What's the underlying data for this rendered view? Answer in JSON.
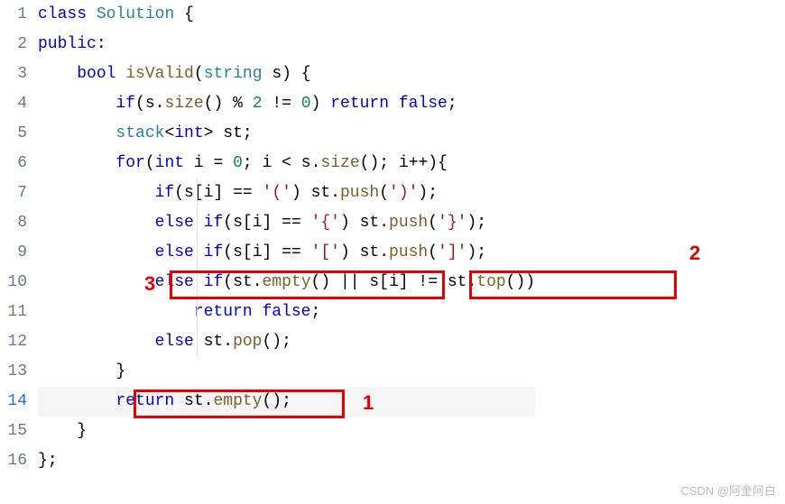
{
  "code": {
    "lines": [
      {
        "num": "1",
        "tokens": [
          [
            "",
            "kw",
            "class"
          ],
          [
            " ",
            "",
            ""
          ],
          [
            "",
            "cls",
            "Solution"
          ],
          [
            " ",
            "",
            ""
          ],
          [
            "",
            "brace",
            "{"
          ]
        ]
      },
      {
        "num": "2",
        "tokens": [
          [
            "",
            "kw",
            "public"
          ],
          [
            "",
            "op",
            ":"
          ]
        ]
      },
      {
        "num": "3",
        "tokens": [
          [
            "    ",
            "",
            ""
          ],
          [
            "",
            "kw",
            "bool"
          ],
          [
            " ",
            "",
            ""
          ],
          [
            "",
            "fn",
            "isValid"
          ],
          [
            "",
            "brace",
            "("
          ],
          [
            "",
            "cls",
            "string"
          ],
          [
            " ",
            "",
            ""
          ],
          [
            "",
            "id",
            "s"
          ],
          [
            "",
            "brace",
            ")"
          ],
          [
            " ",
            "",
            ""
          ],
          [
            "",
            "brace",
            "{"
          ]
        ]
      },
      {
        "num": "4",
        "tokens": [
          [
            "        ",
            "",
            ""
          ],
          [
            "",
            "kw",
            "if"
          ],
          [
            "",
            "brace",
            "("
          ],
          [
            "",
            "id",
            "s"
          ],
          [
            "",
            "op",
            "."
          ],
          [
            "",
            "fn",
            "size"
          ],
          [
            "",
            "brace",
            "()"
          ],
          [
            " ",
            "",
            ""
          ],
          [
            "",
            "op",
            "%"
          ],
          [
            " ",
            "",
            ""
          ],
          [
            "",
            "num",
            "2"
          ],
          [
            " ",
            "",
            ""
          ],
          [
            "",
            "op",
            "!="
          ],
          [
            " ",
            "",
            ""
          ],
          [
            "",
            "num",
            "0"
          ],
          [
            "",
            "brace",
            ")"
          ],
          [
            " ",
            "",
            ""
          ],
          [
            "",
            "kw",
            "return"
          ],
          [
            " ",
            "",
            ""
          ],
          [
            "",
            "kw",
            "false"
          ],
          [
            "",
            "op",
            ";"
          ]
        ]
      },
      {
        "num": "5",
        "tokens": [
          [
            "        ",
            "",
            ""
          ],
          [
            "",
            "cls",
            "stack"
          ],
          [
            "",
            "op",
            "<"
          ],
          [
            "",
            "kw",
            "int"
          ],
          [
            "",
            "op",
            ">"
          ],
          [
            " ",
            "",
            ""
          ],
          [
            "",
            "id",
            "st"
          ],
          [
            "",
            "op",
            ";"
          ]
        ]
      },
      {
        "num": "6",
        "tokens": [
          [
            "        ",
            "",
            ""
          ],
          [
            "",
            "kw",
            "for"
          ],
          [
            "",
            "brace",
            "("
          ],
          [
            "",
            "kw",
            "int"
          ],
          [
            " ",
            "",
            ""
          ],
          [
            "",
            "id",
            "i"
          ],
          [
            " ",
            "",
            ""
          ],
          [
            "",
            "op",
            "="
          ],
          [
            " ",
            "",
            ""
          ],
          [
            "",
            "num",
            "0"
          ],
          [
            "",
            "op",
            ";"
          ],
          [
            " ",
            "",
            ""
          ],
          [
            "",
            "id",
            "i"
          ],
          [
            " ",
            "",
            ""
          ],
          [
            "",
            "op",
            "<"
          ],
          [
            " ",
            "",
            ""
          ],
          [
            "",
            "id",
            "s"
          ],
          [
            "",
            "op",
            "."
          ],
          [
            "",
            "fn",
            "size"
          ],
          [
            "",
            "brace",
            "()"
          ],
          [
            "",
            "op",
            ";"
          ],
          [
            " ",
            "",
            ""
          ],
          [
            "",
            "id",
            "i"
          ],
          [
            "",
            "op",
            "++"
          ],
          [
            "",
            "brace",
            ")"
          ],
          [
            "",
            "brace",
            "{"
          ]
        ]
      },
      {
        "num": "7",
        "tokens": [
          [
            "            ",
            "",
            ""
          ],
          [
            "",
            "kw",
            "if"
          ],
          [
            "",
            "brace",
            "("
          ],
          [
            "",
            "id",
            "s"
          ],
          [
            "",
            "brace",
            "["
          ],
          [
            "",
            "id",
            "i"
          ],
          [
            "",
            "brace",
            "]"
          ],
          [
            " ",
            "",
            ""
          ],
          [
            "",
            "op",
            "=="
          ],
          [
            " ",
            "",
            ""
          ],
          [
            "",
            "str",
            "'('"
          ],
          [
            "",
            "brace",
            ")"
          ],
          [
            " ",
            "",
            ""
          ],
          [
            "",
            "id",
            "st"
          ],
          [
            "",
            "op",
            "."
          ],
          [
            "",
            "fn",
            "push"
          ],
          [
            "",
            "brace",
            "("
          ],
          [
            "",
            "str",
            "')'"
          ],
          [
            "",
            "brace",
            ")"
          ],
          [
            "",
            "op",
            ";"
          ]
        ]
      },
      {
        "num": "8",
        "tokens": [
          [
            "            ",
            "",
            ""
          ],
          [
            "",
            "kw",
            "else"
          ],
          [
            " ",
            "",
            ""
          ],
          [
            "",
            "kw",
            "if"
          ],
          [
            "",
            "brace",
            "("
          ],
          [
            "",
            "id",
            "s"
          ],
          [
            "",
            "brace",
            "["
          ],
          [
            "",
            "id",
            "i"
          ],
          [
            "",
            "brace",
            "]"
          ],
          [
            " ",
            "",
            ""
          ],
          [
            "",
            "op",
            "=="
          ],
          [
            " ",
            "",
            ""
          ],
          [
            "",
            "str",
            "'{'"
          ],
          [
            "",
            "brace",
            ")"
          ],
          [
            " ",
            "",
            ""
          ],
          [
            "",
            "id",
            "st"
          ],
          [
            "",
            "op",
            "."
          ],
          [
            "",
            "fn",
            "push"
          ],
          [
            "",
            "brace",
            "("
          ],
          [
            "",
            "str",
            "'}'"
          ],
          [
            "",
            "brace",
            ")"
          ],
          [
            "",
            "op",
            ";"
          ]
        ]
      },
      {
        "num": "9",
        "tokens": [
          [
            "            ",
            "",
            ""
          ],
          [
            "",
            "kw",
            "else"
          ],
          [
            " ",
            "",
            ""
          ],
          [
            "",
            "kw",
            "if"
          ],
          [
            "",
            "brace",
            "("
          ],
          [
            "",
            "id",
            "s"
          ],
          [
            "",
            "brace",
            "["
          ],
          [
            "",
            "id",
            "i"
          ],
          [
            "",
            "brace",
            "]"
          ],
          [
            " ",
            "",
            ""
          ],
          [
            "",
            "op",
            "=="
          ],
          [
            " ",
            "",
            ""
          ],
          [
            "",
            "str",
            "'['"
          ],
          [
            "",
            "brace",
            ")"
          ],
          [
            " ",
            "",
            ""
          ],
          [
            "",
            "id",
            "st"
          ],
          [
            "",
            "op",
            "."
          ],
          [
            "",
            "fn",
            "push"
          ],
          [
            "",
            "brace",
            "("
          ],
          [
            "",
            "str",
            "']'"
          ],
          [
            "",
            "brace",
            ")"
          ],
          [
            "",
            "op",
            ";"
          ]
        ]
      },
      {
        "num": "10",
        "tokens": [
          [
            "            ",
            "",
            ""
          ],
          [
            "",
            "kw",
            "else"
          ],
          [
            " ",
            "",
            ""
          ],
          [
            "",
            "kw",
            "if"
          ],
          [
            "",
            "brace",
            "("
          ],
          [
            "",
            "id",
            "st"
          ],
          [
            "",
            "op",
            "."
          ],
          [
            "",
            "fn",
            "empty"
          ],
          [
            "",
            "brace",
            "()"
          ],
          [
            " ",
            "",
            ""
          ],
          [
            "",
            "op",
            "||"
          ],
          [
            " ",
            "",
            ""
          ],
          [
            "",
            "id",
            "s"
          ],
          [
            "",
            "brace",
            "["
          ],
          [
            "",
            "id",
            "i"
          ],
          [
            "",
            "brace",
            "]"
          ],
          [
            " ",
            "",
            ""
          ],
          [
            "",
            "op",
            "!="
          ],
          [
            " ",
            "",
            ""
          ],
          [
            "",
            "id",
            "st"
          ],
          [
            "",
            "op",
            "."
          ],
          [
            "",
            "fn",
            "top"
          ],
          [
            "",
            "brace",
            "()"
          ],
          [
            "",
            "brace",
            ")"
          ]
        ]
      },
      {
        "num": "11",
        "tokens": [
          [
            "                ",
            "",
            ""
          ],
          [
            "",
            "kw",
            "return"
          ],
          [
            " ",
            "",
            ""
          ],
          [
            "",
            "kw",
            "false"
          ],
          [
            "",
            "op",
            ";"
          ]
        ]
      },
      {
        "num": "12",
        "tokens": [
          [
            "            ",
            "",
            ""
          ],
          [
            "",
            "kw",
            "else"
          ],
          [
            " ",
            "",
            ""
          ],
          [
            "",
            "id",
            "st"
          ],
          [
            "",
            "op",
            "."
          ],
          [
            "",
            "fn",
            "pop"
          ],
          [
            "",
            "brace",
            "()"
          ],
          [
            "",
            "op",
            ";"
          ]
        ]
      },
      {
        "num": "13",
        "tokens": [
          [
            "        ",
            "",
            ""
          ],
          [
            "",
            "brace",
            "}"
          ]
        ]
      },
      {
        "num": "14",
        "current": true,
        "tokens": [
          [
            "        ",
            "",
            ""
          ],
          [
            "",
            "kw",
            "return"
          ],
          [
            " ",
            "",
            ""
          ],
          [
            "",
            "id",
            "st"
          ],
          [
            "",
            "op",
            "."
          ],
          [
            "",
            "fn",
            "empty"
          ],
          [
            "",
            "brace",
            "()"
          ],
          [
            "",
            "op",
            ";"
          ]
        ]
      },
      {
        "num": "15",
        "tokens": [
          [
            "    ",
            "",
            ""
          ],
          [
            "",
            "brace",
            "}"
          ]
        ]
      },
      {
        "num": "16",
        "tokens": [
          [
            "",
            "brace",
            "}"
          ],
          [
            "",
            "op",
            ";"
          ]
        ]
      }
    ]
  },
  "annotations": {
    "labels": {
      "a1": "1",
      "a2": "2",
      "a3": "3"
    }
  },
  "watermark": "CSDN @阿奎阿白"
}
